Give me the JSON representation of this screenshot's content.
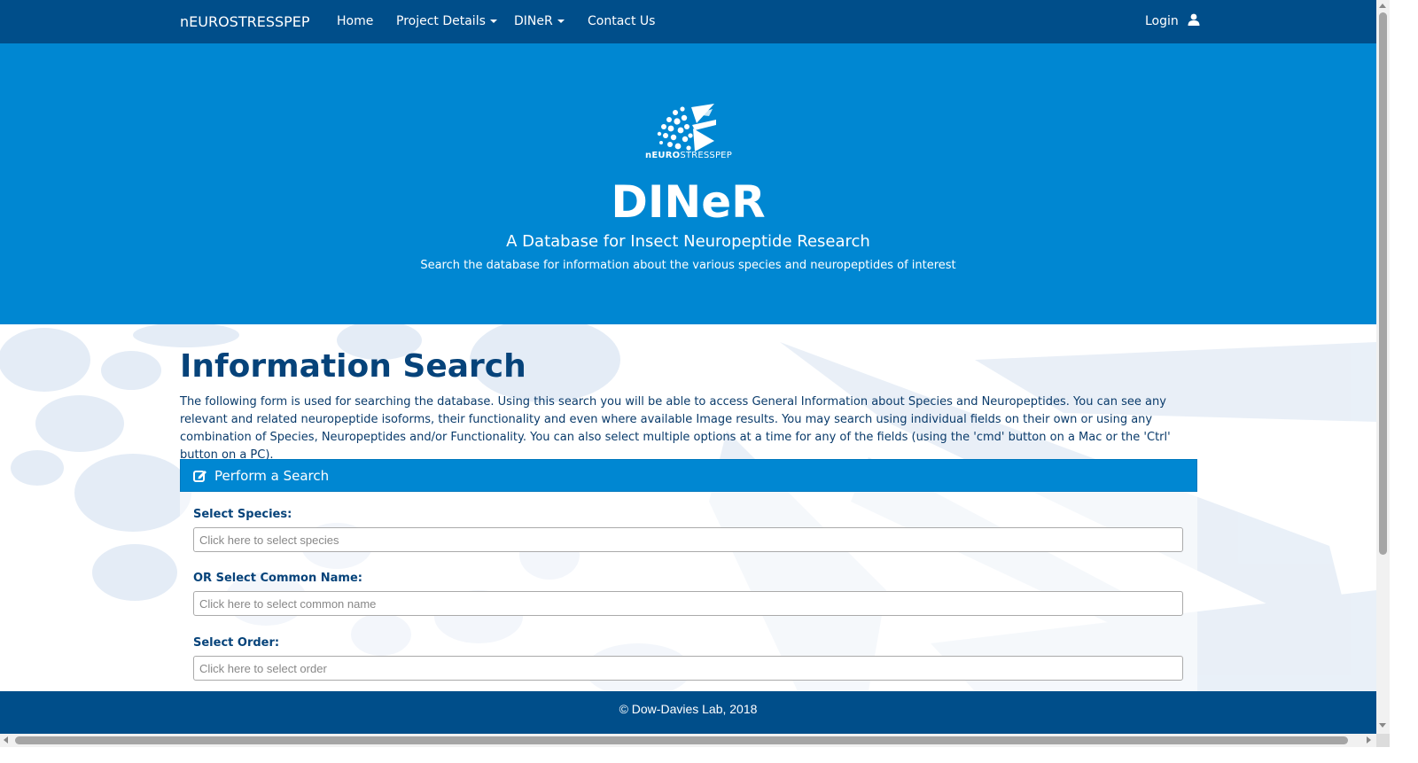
{
  "navbar": {
    "brand": "nEUROSTRESSPEP",
    "items": [
      {
        "label": "Home",
        "dropdown": false
      },
      {
        "label": "Project Details",
        "dropdown": true
      },
      {
        "label": "DINeR",
        "dropdown": true
      },
      {
        "label": "Contact Us",
        "dropdown": false
      }
    ],
    "login": "Login",
    "login_icon": "user-icon"
  },
  "hero": {
    "logo_text_bold": "nEURO",
    "logo_text_rest": "STRESSPEP",
    "title": "DINeR",
    "subtitle": "A Database for Insect Neuropeptide Research",
    "description": "Search the database for information about the various species and neuropeptides of interest"
  },
  "main": {
    "title": "Information Search",
    "intro": "The following form is used for searching the database. Using this search you will be able to access General Information about Species and Neuropeptides. You can see any relevant and related neuropeptide isoforms, their functionality and even where available Image results. You may search using individual fields on their own or using any combination of Species, Neuropeptides and/or Functionality. You can also select multiple options at a time for any of the fields (using the 'cmd' button on a Mac or the 'Ctrl' button on a PC).",
    "panel": {
      "title": "Perform a Search",
      "icon": "edit-icon",
      "fields": [
        {
          "label": "Select Species:",
          "placeholder": "Click here to select species"
        },
        {
          "label": "OR Select Common Name:",
          "placeholder": "Click here to select common name"
        },
        {
          "label": "Select Order:",
          "placeholder": "Click here to select order"
        }
      ]
    }
  },
  "footer": {
    "text": "© Dow-Davies Lab, 2018"
  },
  "colors": {
    "navbar": "#004e8a",
    "hero": "#0087d2",
    "heading": "#06437a"
  }
}
